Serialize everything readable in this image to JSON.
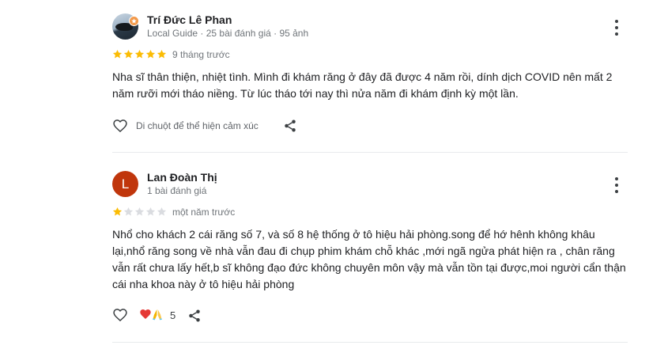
{
  "reviews": [
    {
      "name": "Trí Đức Lê Phan",
      "meta": "Local Guide · 25 bài đánh giá · 95 ảnh",
      "rating": 5,
      "time": "9 tháng trước",
      "text": "Nha sĩ thân thiện, nhiệt tình. Mình đi khám răng ở đây đã được 4 năm rồi, dính dịch COVID nên mất 2 năm rưỡi mới tháo niềng. Từ lúc tháo tới nay thì nửa năm đi khám định kỳ một lần.",
      "like_hint": "Di chuột để thể hiện cảm xúc"
    },
    {
      "name": "Lan Đoàn Thị",
      "avatar_letter": "L",
      "meta": "1 bài đánh giá",
      "rating": 1,
      "time": "một năm trước",
      "text": "Nhổ cho khách 2 cái răng số 7, và số 8 hệ thống ở tô hiệu hải phòng.song để hớ hênh không khâu lại,nhổ răng song về nhà vẫn đau đi chụp phim khám chỗ khác ,mới ngã ngửa phát hiện ra , chân răng vẫn rất chưa lấy hết,b sĩ không đạo đức không chuyên môn vậy mà vẫn tồn tại được,moi người cẩn thận cái nha khoa này ở tô hiệu hải phòng",
      "reaction_count": "5"
    }
  ],
  "colors": {
    "star_filled": "#fbbc04",
    "star_empty": "#dadce0",
    "avatar_l": "#c0360c",
    "badge": "#f2994a"
  }
}
